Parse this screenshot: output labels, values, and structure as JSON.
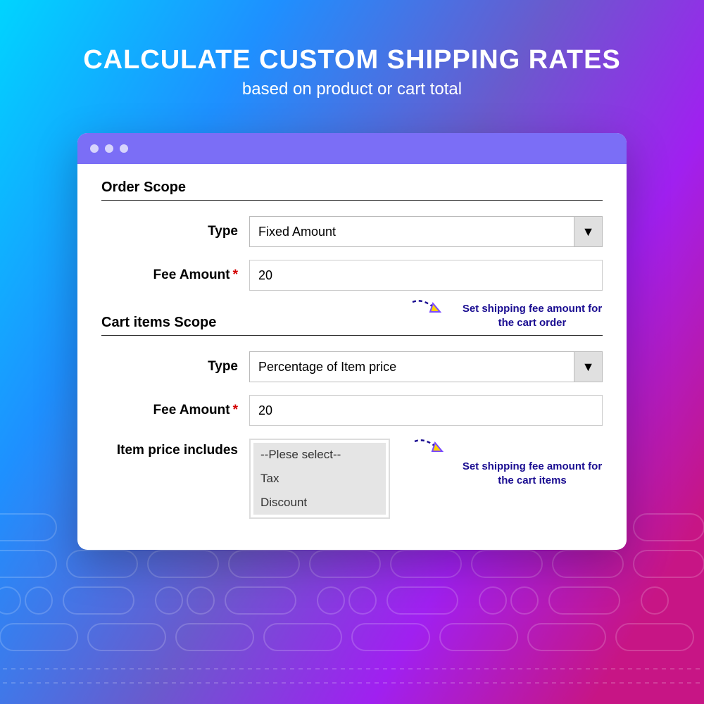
{
  "header": {
    "title": "CALCULATE CUSTOM SHIPPING RATES",
    "subtitle": "based on product or cart total"
  },
  "orderScope": {
    "heading": "Order Scope",
    "typeLabel": "Type",
    "typeValue": "Fixed Amount",
    "feeLabel": "Fee Amount",
    "feeValue": "20",
    "callout": "Set shipping fee amount for the cart order"
  },
  "cartScope": {
    "heading": "Cart items Scope",
    "typeLabel": "Type",
    "typeValue": "Percentage of Item price",
    "feeLabel": "Fee Amount",
    "feeValue": "20",
    "includesLabel": "Item price includes",
    "options": {
      "0": "--Plese select--",
      "1": "Tax",
      "2": "Discount"
    },
    "callout": "Set shipping fee amount for the cart items"
  }
}
